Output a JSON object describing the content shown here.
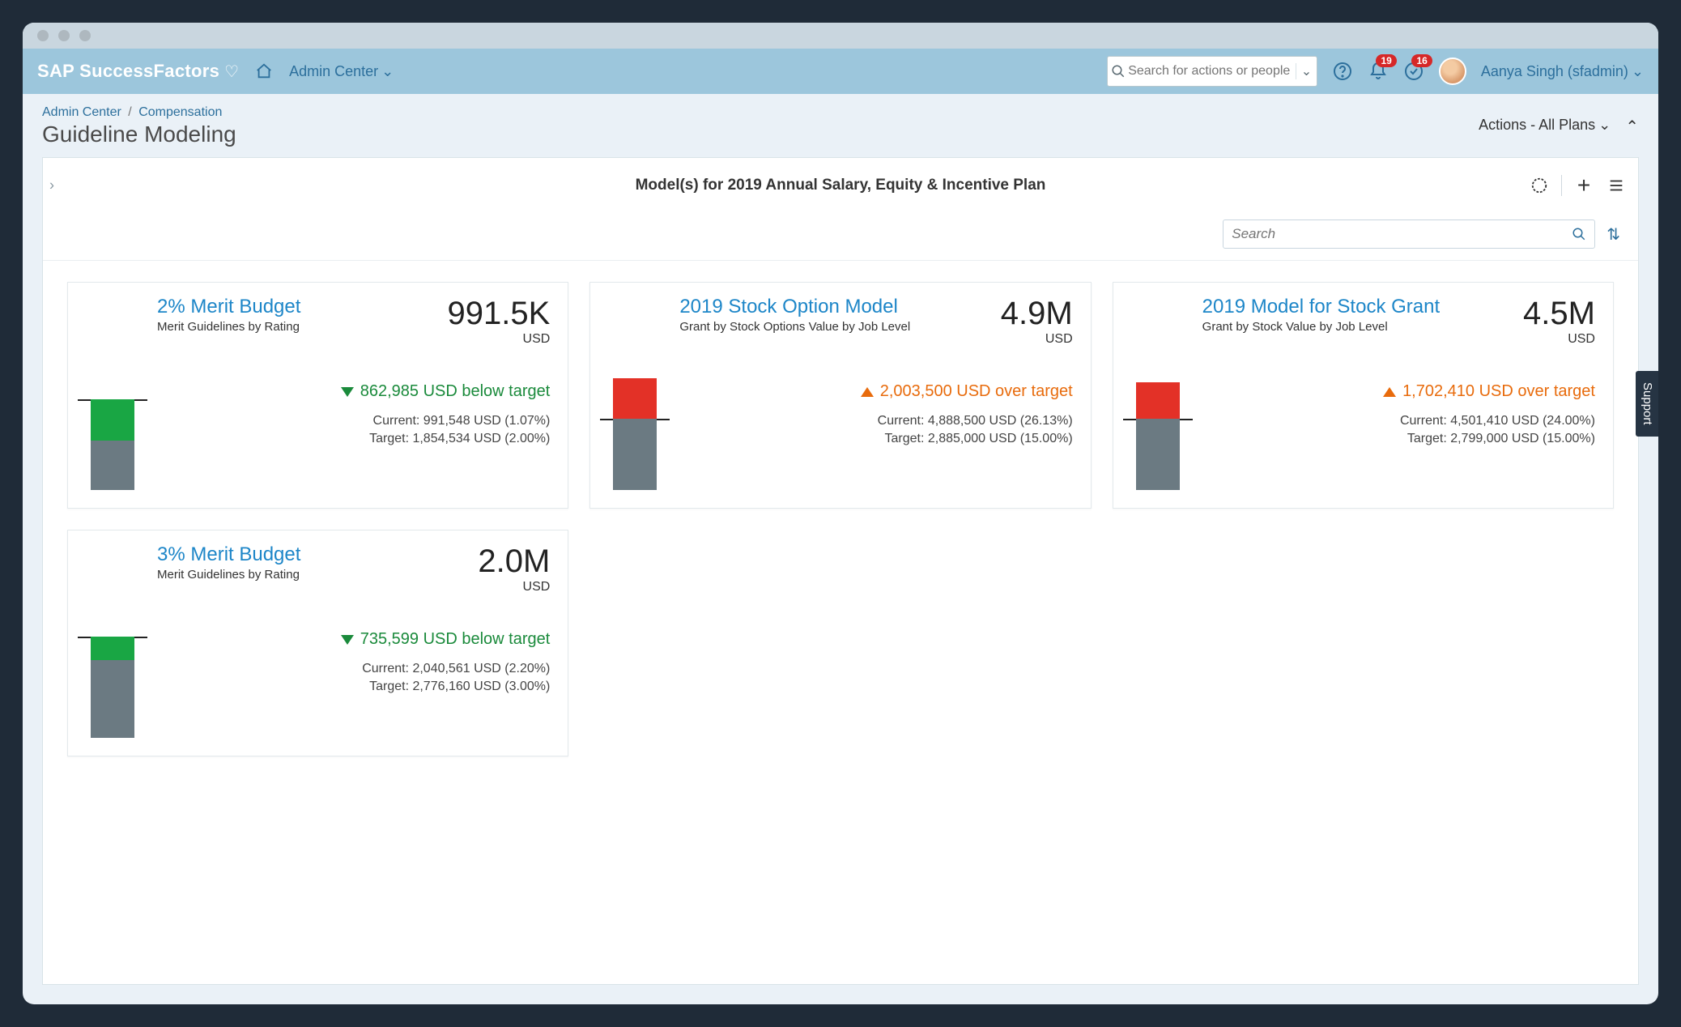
{
  "brand": "SAP SuccessFactors",
  "header": {
    "nav_label": "Admin Center",
    "search_placeholder": "Search for actions or people",
    "notif_badge": "19",
    "task_badge": "16",
    "user_display": "Aanya Singh (sfadmin)"
  },
  "breadcrumb": {
    "root": "Admin Center",
    "leaf": "Compensation"
  },
  "page_title": "Guideline Modeling",
  "actions_label": "Actions - All Plans",
  "panel_title": "Model(s) for 2019 Annual Salary, Equity & Incentive Plan",
  "inner_search_placeholder": "Search",
  "support_label": "Support",
  "cards": [
    {
      "title": "2% Merit Budget",
      "subtitle": "Merit Guidelines by Rating",
      "value": "991.5K",
      "ccy": "USD",
      "delta_dir": "down",
      "delta_color": "green",
      "delta_text": "862,985 USD below target",
      "current": "Current: 991,548 USD (1.07%)",
      "target": "Target: 1,854,534 USD (2.00%)",
      "gauge": {
        "type": "below",
        "line_pct": 30,
        "fill_top_pct": 30,
        "fill_bot_pct": 62
      }
    },
    {
      "title": "2019 Stock Option Model",
      "subtitle": "Grant by Stock Options Value by Job Level",
      "value": "4.9M",
      "ccy": "USD",
      "delta_dir": "up",
      "delta_color": "orange",
      "delta_text": "2,003,500 USD over target",
      "current": "Current: 4,888,500 USD (26.13%)",
      "target": "Target: 2,885,000 USD (15.00%)",
      "gauge": {
        "type": "over",
        "line_pct": 45,
        "over_top_pct": 14,
        "base_top_pct": 45
      }
    },
    {
      "title": "2019 Model for Stock Grant",
      "subtitle": "Grant by Stock Value by Job Level",
      "value": "4.5M",
      "ccy": "USD",
      "delta_dir": "up",
      "delta_color": "orange",
      "delta_text": "1,702,410 USD over target",
      "current": "Current: 4,501,410 USD (24.00%)",
      "target": "Target: 2,799,000 USD (15.00%)",
      "gauge": {
        "type": "over",
        "line_pct": 45,
        "over_top_pct": 17,
        "base_top_pct": 45
      }
    },
    {
      "title": "3% Merit Budget",
      "subtitle": "Merit Guidelines by Rating",
      "value": "2.0M",
      "ccy": "USD",
      "delta_dir": "down",
      "delta_color": "green",
      "delta_text": "735,599 USD below target",
      "current": "Current: 2,040,561 USD (2.20%)",
      "target": "Target: 2,776,160 USD (3.00%)",
      "gauge": {
        "type": "below",
        "line_pct": 22,
        "fill_top_pct": 22,
        "fill_bot_pct": 40
      }
    }
  ],
  "chart_data": [
    {
      "title": "2% Merit Budget",
      "type": "bar",
      "series": [
        {
          "name": "Current",
          "values": [
            991548
          ]
        },
        {
          "name": "Target",
          "values": [
            1854534
          ]
        }
      ],
      "categories": [
        "USD"
      ],
      "ylabel": "USD"
    },
    {
      "title": "2019 Stock Option Model",
      "type": "bar",
      "series": [
        {
          "name": "Current",
          "values": [
            4888500
          ]
        },
        {
          "name": "Target",
          "values": [
            2885000
          ]
        }
      ],
      "categories": [
        "USD"
      ],
      "ylabel": "USD"
    },
    {
      "title": "2019 Model for Stock Grant",
      "type": "bar",
      "series": [
        {
          "name": "Current",
          "values": [
            4501410
          ]
        },
        {
          "name": "Target",
          "values": [
            2799000
          ]
        }
      ],
      "categories": [
        "USD"
      ],
      "ylabel": "USD"
    },
    {
      "title": "3% Merit Budget",
      "type": "bar",
      "series": [
        {
          "name": "Current",
          "values": [
            2040561
          ]
        },
        {
          "name": "Target",
          "values": [
            2776160
          ]
        }
      ],
      "categories": [
        "USD"
      ],
      "ylabel": "USD"
    }
  ]
}
